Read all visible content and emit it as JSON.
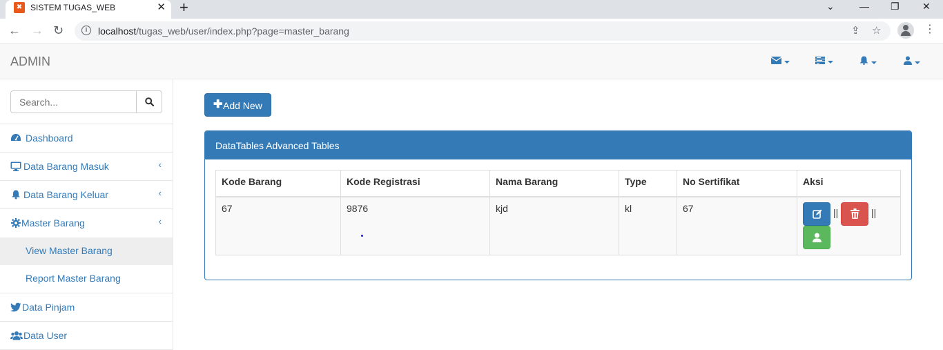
{
  "browser": {
    "tab_title": "SISTEM TUGAS_WEB",
    "tab_close": "✕",
    "new_tab": "+",
    "url_host": "localhost",
    "url_path": "/tugas_web/user/index.php?page=master_barang",
    "back": "←",
    "forward": "→",
    "reload": "↻",
    "window_controls": {
      "minimize": "—",
      "restore": "❐",
      "close": "✕",
      "chevron": "⌄"
    }
  },
  "navbar": {
    "brand": "ADMIN",
    "menus": [
      {
        "name": "messages-menu",
        "icon": "envelope-icon"
      },
      {
        "name": "tasks-menu",
        "icon": "tasks-icon"
      },
      {
        "name": "alerts-menu",
        "icon": "bell-icon"
      },
      {
        "name": "user-menu",
        "icon": "user-icon"
      }
    ]
  },
  "sidebar": {
    "search_placeholder": "Search...",
    "items": [
      {
        "label": "Dashboard",
        "icon": "dashboard-icon",
        "has_arrow": false
      },
      {
        "label": "Data Barang Masuk",
        "icon": "desktop-icon",
        "has_arrow": true
      },
      {
        "label": "Data Barang Keluar",
        "icon": "bell-icon",
        "has_arrow": true
      },
      {
        "label": "Master Barang",
        "icon": "gear-icon",
        "has_arrow": true
      },
      {
        "label": "Data Pinjam",
        "icon": "twitter-icon",
        "has_arrow": false
      },
      {
        "label": "Data User",
        "icon": "users-icon",
        "has_arrow": false
      }
    ],
    "subitems": [
      {
        "label": "View Master Barang",
        "active": true
      },
      {
        "label": "Report Master Barang",
        "active": false
      }
    ],
    "arrow_glyph": "‹"
  },
  "main": {
    "add_button": "Add New",
    "panel_title": "DataTables Advanced Tables",
    "table": {
      "headers": [
        "Kode Barang",
        "Kode Registrasi",
        "Nama Barang",
        "Type",
        "No Sertifikat",
        "Aksi"
      ],
      "rows": [
        [
          "67",
          "9876",
          "kjd",
          "kl",
          "67"
        ]
      ]
    },
    "action_separator": "||"
  },
  "colors": {
    "primary": "#337ab7",
    "danger": "#d9534f",
    "success": "#5cb85c"
  }
}
